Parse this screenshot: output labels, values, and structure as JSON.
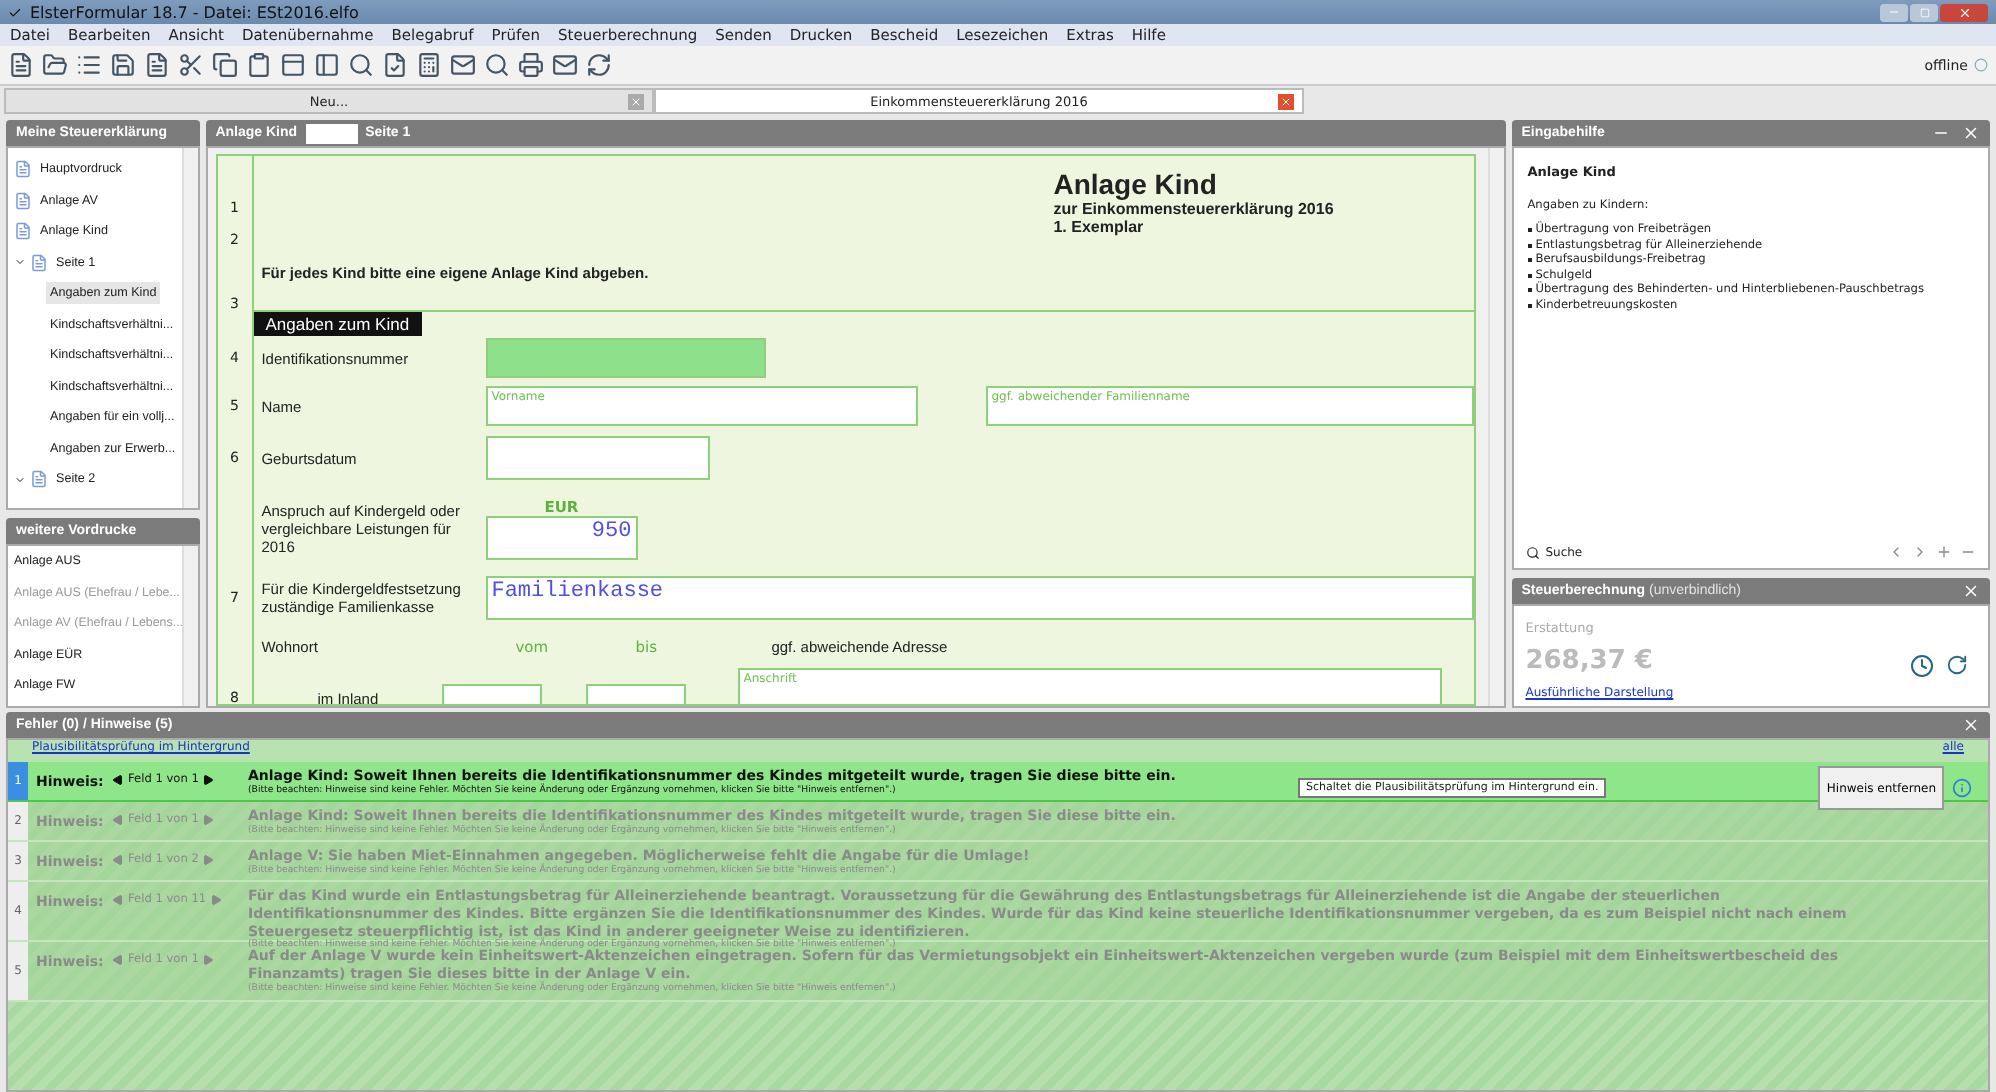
{
  "window": {
    "title": "ElsterFormular 18.7 - Datei: ESt2016.elfo"
  },
  "menu": [
    "Datei",
    "Bearbeiten",
    "Ansicht",
    "Datenübernahme",
    "Belegabruf",
    "Prüfen",
    "Steuerberechnung",
    "Senden",
    "Drucken",
    "Bescheid",
    "Lesezeichen",
    "Extras",
    "Hilfe"
  ],
  "status": "offline",
  "tabs": [
    {
      "label": "Neu...",
      "selected": false
    },
    {
      "label": "Einkommensteuererklärung 2016",
      "selected": true
    }
  ],
  "tree": {
    "title": "Meine Steuererklärung",
    "items": [
      {
        "label": "Hauptvordruck",
        "selected": false
      },
      {
        "label": "Anlage AV",
        "selected": false
      },
      {
        "label": "Anlage Kind",
        "selected": false
      },
      {
        "label": "Seite 1",
        "selected": false,
        "expanded": true,
        "children": [
          {
            "label": "Angaben zum Kind",
            "selected": true
          },
          {
            "label": "Kindschaftsverhältni...",
            "selected": false
          },
          {
            "label": "Kindschaftsverhältni...",
            "selected": false
          },
          {
            "label": "Kindschaftsverhältni...",
            "selected": false
          },
          {
            "label": "Angaben für ein vollj...",
            "selected": false
          },
          {
            "label": "Angaben zur Erwerb...",
            "selected": false
          }
        ]
      },
      {
        "label": "Seite 2",
        "selected": false,
        "expanded": true
      }
    ]
  },
  "more_forms": {
    "title": "weitere Vordrucke",
    "items": [
      {
        "label": "Anlage AUS",
        "disabled": false
      },
      {
        "label": "Anlage AUS (Ehefrau / Lebe...",
        "disabled": true
      },
      {
        "label": "Anlage AV (Ehefrau / Lebens...",
        "disabled": true
      },
      {
        "label": "Anlage EÜR",
        "disabled": false
      },
      {
        "label": "Anlage FW",
        "disabled": false
      }
    ]
  },
  "form": {
    "panel_title": "Anlage Kind",
    "panel_page": "Seite 1",
    "title": "Anlage Kind",
    "subtitle": "zur Einkommensteuererklärung 2016",
    "copy": "1. Exemplar",
    "top_lines": [
      "1",
      "2",
      "3"
    ],
    "instruction": "Für jedes Kind bitte eine eigene Anlage Kind abgeben.",
    "section": "Angaben zum Kind",
    "rows": [
      {
        "kind": "id",
        "line": "4",
        "label": "Identifikationsnummer"
      },
      {
        "kind": "name",
        "line": "5",
        "label": "Name",
        "placeholders": [
          "Vorname",
          "ggf. abweichender Familienname"
        ]
      },
      {
        "kind": "date",
        "line": "6",
        "label": "Geburtsdatum"
      },
      {
        "kind": "amount",
        "line": "",
        "label": "Anspruch auf Kindergeld oder vergleichbare Leistungen für 2016",
        "unit": "EUR",
        "value": "950"
      },
      {
        "kind": "text",
        "line": "7",
        "label": "Für die Kindergeldfestsetzung zuständige Familienkasse",
        "value": "Familienkasse"
      },
      {
        "kind": "heading",
        "line": "",
        "label": "Wohnort",
        "columns": [
          "vom",
          "bis",
          "ggf. abweichende Adresse"
        ]
      },
      {
        "kind": "address",
        "line": "8",
        "label": "im Inland",
        "placeholder": "Anschrift"
      }
    ]
  },
  "help": {
    "title": "Eingabehilfe",
    "heading": "Anlage Kind",
    "intro": "Angaben zu Kindern:",
    "bullets": [
      "Übertragung von Freibeträgen",
      "Entlastungsbetrag für Alleinerziehende",
      "Berufsausbildungs-Freibetrag",
      "Schulgeld",
      "Übertragung des Behinderten- und Hinterbliebenen-Pauschbetrags",
      "Kinderbetreuungskosten"
    ],
    "search": "Suche"
  },
  "tax": {
    "title": "Steuerberechnung",
    "note": "(unverbindlich)",
    "label": "Erstattung",
    "amount": "268,37 €",
    "link": "Ausführliche Darstellung"
  },
  "messages": {
    "title": "Fehler (0) / Hinweise (5)",
    "toggle_link": "Plausibilitätsprüfung im Hintergrund",
    "all_link": "alle",
    "tooltip": "Schaltet die Plausibilitätsprüfung im Hintergrund ein.",
    "remove_button": "Hinweis entfernen",
    "rows": [
      {
        "number": "1",
        "label": "Hinweis:",
        "field": "Feld 1 von 1",
        "text": "Anlage Kind: Soweit Ihnen bereits die Identifikationsnummer des Kindes mitgeteilt wurde, tragen Sie diese bitte ein.",
        "note": "(Bitte beachten: Hinweise sind keine Fehler. Möchten Sie keine Änderung oder Ergänzung vornehmen, klicken Sie bitte \"Hinweis entfernen\".)",
        "selected": true
      },
      {
        "number": "2",
        "label": "Hinweis:",
        "field": "Feld 1 von 1",
        "text": "Anlage Kind: Soweit Ihnen bereits die Identifikationsnummer des Kindes mitgeteilt wurde, tragen Sie diese bitte ein.",
        "note": "(Bitte beachten: Hinweise sind keine Fehler. Möchten Sie keine Änderung oder Ergänzung vornehmen, klicken Sie bitte \"Hinweis entfernen\".)",
        "selected": false
      },
      {
        "number": "3",
        "label": "Hinweis:",
        "field": "Feld 1 von 2",
        "text": "Anlage V: Sie haben Miet-Einnahmen angegeben. Möglicherweise fehlt die Angabe für die Umlage!",
        "note": "(Bitte beachten: Hinweise sind keine Fehler. Möchten Sie keine Änderung oder Ergänzung vornehmen, klicken Sie bitte \"Hinweis entfernen\".)",
        "selected": false
      },
      {
        "number": "4",
        "label": "Hinweis:",
        "field": "Feld 1 von 11",
        "text": "Für das Kind wurde ein Entlastungsbetrag für Alleinerziehende beantragt. Voraussetzung für die Gewährung des Entlastungsbetrags für Alleinerziehende ist die Angabe der steuerlichen Identifikationsnummer des Kindes. Bitte ergänzen Sie die Identifikationsnummer des Kindes. Wurde für das Kind keine steuerliche Identifikationsnummer vergeben, da es zum Beispiel nicht nach einem Steuergesetz steuerpflichtig ist, ist das Kind in anderer geeigneter Weise zu identifizieren.",
        "note": "(Bitte beachten: Hinweise sind keine Fehler. Möchten Sie keine Änderung oder Ergänzung vornehmen, klicken Sie bitte \"Hinweis entfernen\".)",
        "selected": false
      },
      {
        "number": "5",
        "label": "Hinweis:",
        "field": "Feld 1 von 1",
        "text": "Auf der Anlage V wurde kein Einheitswert-Aktenzeichen eingetragen. Sofern für das Vermietungsobjekt ein Einheitswert-Aktenzeichen vergeben wurde (zum Beispiel mit dem Einheitswertbescheid des Finanzamts) tragen Sie dieses bitte in der Anlage V ein.",
        "note": "(Bitte beachten: Hinweise sind keine Fehler. Möchten Sie keine Änderung oder Ergänzung vornehmen, klicken Sie bitte \"Hinweis entfernen\".)",
        "selected": false
      }
    ]
  }
}
